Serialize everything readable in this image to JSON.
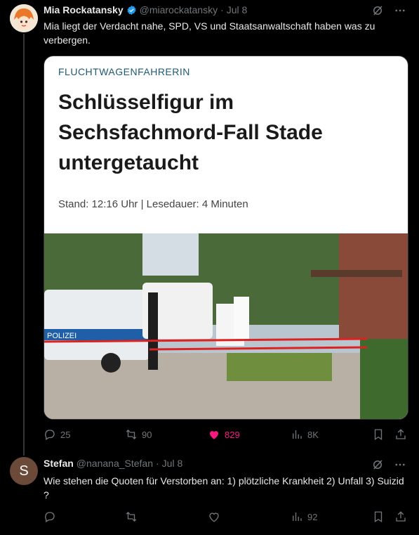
{
  "tweet": {
    "author_name": "Mia Rockatansky",
    "handle": "@miarockatansky",
    "separator": "·",
    "time": "Jul 8",
    "text": "Mia liegt der Verdacht nahe, SPD, VS und Staatsanwaltschaft haben was zu verbergen.",
    "card": {
      "kicker": "FLUCHTWAGENFAHRERIN",
      "headline": "Schlüsselfigur im Sechsfachmord-Fall Stade untergetaucht",
      "meta": "Stand: 12:16 Uhr | Lesedauer: 4 Minuten",
      "photo_label": "POLIZEI"
    },
    "metrics": {
      "replies": "25",
      "retweets": "90",
      "likes": "829",
      "views": "8K"
    },
    "accent_color": "#1d9bf0",
    "like_color": "#f91880"
  },
  "reply": {
    "avatar_letter": "S",
    "author_name": "Stefan",
    "handle": "@nanana_Stefan",
    "separator": "·",
    "time": "Jul 8",
    "text": "Wie stehen die Quoten für Verstorben an: 1) plötzliche Krankheit 2) Unfall 3) Suizid ?",
    "metrics": {
      "views": "92"
    }
  }
}
